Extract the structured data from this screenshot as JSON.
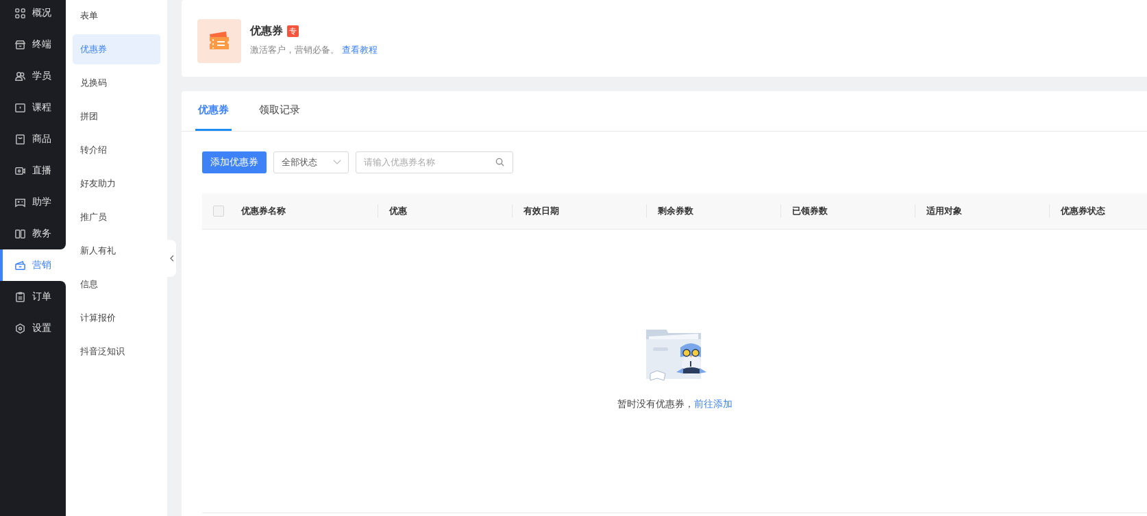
{
  "nav": {
    "items": [
      {
        "label": "概况",
        "selected": false
      },
      {
        "label": "终端",
        "selected": false
      },
      {
        "label": "学员",
        "selected": false
      },
      {
        "label": "课程",
        "selected": false
      },
      {
        "label": "商品",
        "selected": false
      },
      {
        "label": "直播",
        "selected": false
      },
      {
        "label": "助学",
        "selected": false
      },
      {
        "label": "教务",
        "selected": false
      },
      {
        "label": "营销",
        "selected": true
      },
      {
        "label": "订单",
        "selected": false
      },
      {
        "label": "设置",
        "selected": false
      }
    ]
  },
  "submenu": {
    "items": [
      {
        "label": "表单",
        "selected": false
      },
      {
        "label": "优惠券",
        "selected": true
      },
      {
        "label": "兑换码",
        "selected": false
      },
      {
        "label": "拼团",
        "selected": false
      },
      {
        "label": "转介绍",
        "selected": false
      },
      {
        "label": "好友助力",
        "selected": false
      },
      {
        "label": "推广员",
        "selected": false
      },
      {
        "label": "新人有礼",
        "selected": false
      },
      {
        "label": "信息",
        "selected": false
      },
      {
        "label": "计算报价",
        "selected": false
      },
      {
        "label": "抖音泛知识",
        "selected": false
      }
    ]
  },
  "header": {
    "title": "优惠券",
    "badge": "专",
    "description": "激活客户，营销必备。",
    "link": "查看教程"
  },
  "tabs": [
    {
      "label": "优惠券",
      "selected": true
    },
    {
      "label": "领取记录",
      "selected": false
    }
  ],
  "toolbar": {
    "add_button": "添加优惠券",
    "status_select": {
      "value": "全部状态"
    },
    "search": {
      "placeholder": "请输入优惠券名称"
    }
  },
  "table": {
    "select_all_checked": false,
    "columns": [
      "优惠券名称",
      "优惠",
      "有效日期",
      "剩余券数",
      "已领券数",
      "适用对象",
      "优惠券状态"
    ]
  },
  "empty_state": {
    "message": "暂时没有优惠券，",
    "link": "前往添加"
  }
}
